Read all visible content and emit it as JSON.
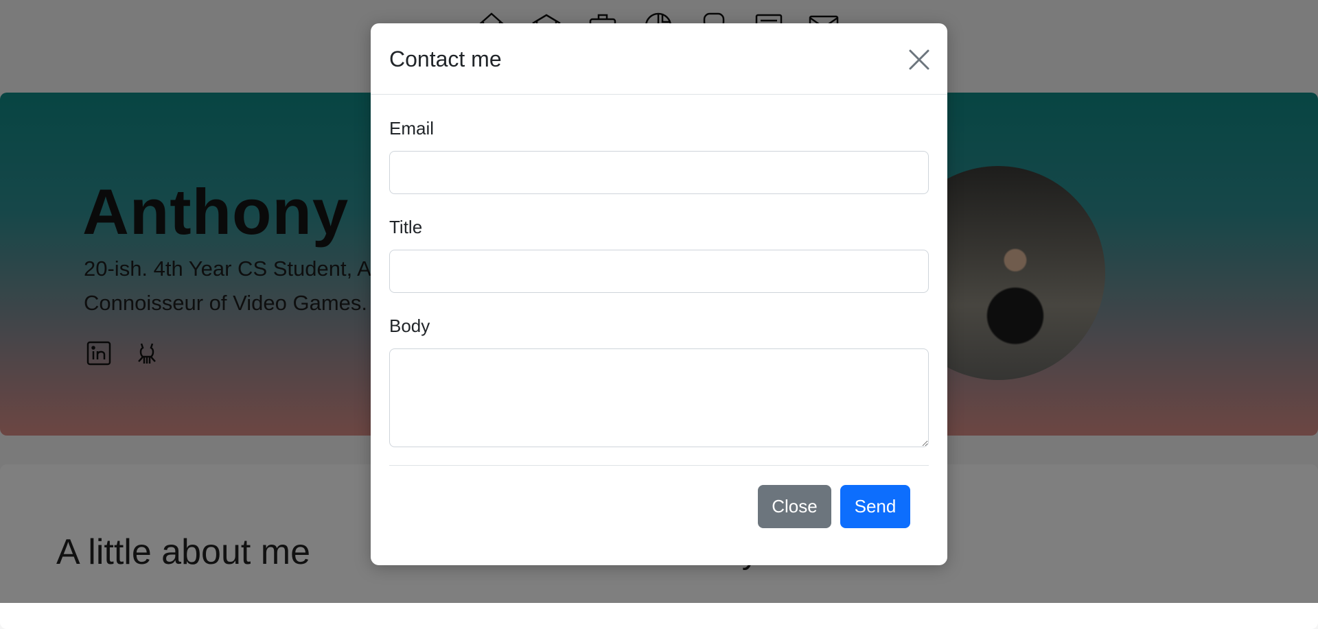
{
  "nav": {
    "icons": [
      "home-icon",
      "house-icon",
      "briefcase-icon",
      "pie-chart-icon",
      "joystick-icon",
      "document-icon",
      "envelope-icon"
    ]
  },
  "hero": {
    "name": "Anthony",
    "tagline": "20-ish. 4th Year CS Student, A Connoisseur of Video Games.",
    "social": [
      "linkedin-icon",
      "github-icon"
    ]
  },
  "about": {
    "heading": "A little about me",
    "skills_heading": "Key Skills"
  },
  "modal": {
    "title": "Contact me",
    "fields": {
      "email_label": "Email",
      "email_value": "",
      "title_label": "Title",
      "title_value": "",
      "body_label": "Body",
      "body_value": ""
    },
    "buttons": {
      "close_label": "Close",
      "send_label": "Send"
    }
  },
  "colors": {
    "primary": "#0d6efd",
    "secondary": "#6c757d",
    "overlay": "rgba(0,0,0,0.5)",
    "hero_top": "#0f8a86",
    "hero_bottom": "#d98c86"
  }
}
